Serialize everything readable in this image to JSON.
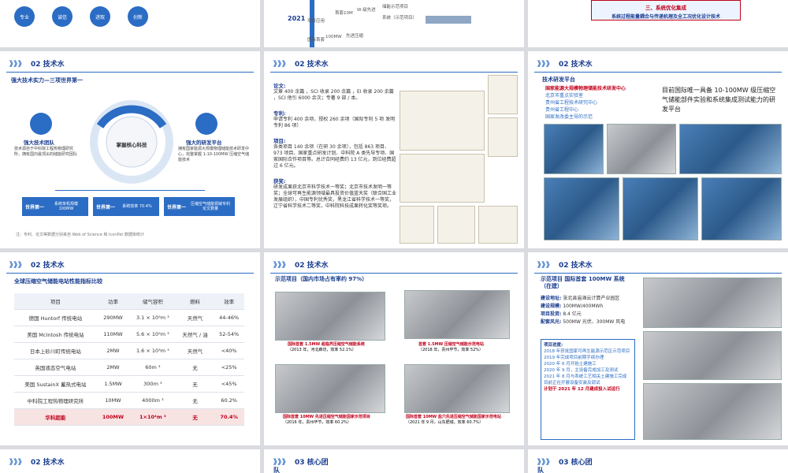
{
  "section_technical": "02  技术水",
  "section_core_team": "03  核心团",
  "section_core_team_tail": "队",
  "top_strip": {
    "tags": [
      "专业",
      "诚信",
      "进取",
      "创新"
    ],
    "timeline_year": "2021",
    "timeline_items": [
      "首套10M",
      "W 级先进",
      "储能示范项目",
      "系统（示范项目）",
      "国际首套",
      "100MW",
      "先进压缩"
    ],
    "timeline_labels": [
      "项目应用",
      "项目应用"
    ],
    "system_title": "三、系统优化集成",
    "system_desc": "系统过程能量耦合与传递机理及全工况优化设计技术"
  },
  "slide4": {
    "title": "强大技术实力—三项世界第一",
    "center": "掌握核心科技",
    "left_title": "强大技术团队",
    "left_desc": "技术源自于中科院工程热物理研究所，拥有国内最顶尖的储能研究团队",
    "right_title": "强大的研发平台",
    "right_desc": "拥有国家能源大规模物理储能技术研发中心，完整掌握 1-10-100MW 压缩空气储能技术",
    "boxes": [
      {
        "label": "世界第一",
        "text": "系统单机规模 100MW"
      },
      {
        "label": "世界第一",
        "text": "系统效率 70.4%"
      },
      {
        "label": "世界第一",
        "text": "压缩空气储能领域专利论文数量"
      }
    ],
    "note": "注：专利、论文等数据分别来自 Web of Science 和 IconPat 数据库统计"
  },
  "slide5": {
    "sections": [
      {
        "title": "论文:",
        "text": "文章 400 余篇 ，SCI 收录 200 余篇 ，EI 收录 200 余篇 ，SCI 他引 6000 余次；专著 9 部 / 本。"
      },
      {
        "title": "专利:",
        "text": "申请专利 400 余项，授权 260 余项（国际专利 5 项 发明专利 86 项）"
      },
      {
        "title": "项目:",
        "text": "各类项目 140 余项（在研 30 余项），包括 863 项目、973 项目、国家重点研发计划、中科院 A 类先导专项、国家国际合作项目等。总计合同经费约 13 亿元，到位经费超过 6 亿元。"
      },
      {
        "title": "获奖:",
        "text": "研发成果获北京市科学技术一等奖；北京市技术发明一等奖；全球可再生能源领域最具投资价值蓝天奖（联合国工业发展组织），中国专利优秀奖，黑龙江省科学技术一等奖，辽宁省科学技术二等奖，中科院科技成果转化奖等奖项。"
      }
    ]
  },
  "slide6": {
    "heading": "技术研发平台",
    "bullets": [
      "国家能源大规模物理储能技术研发中心",
      "北京市重点实验室",
      "贵州省工程技术研究中心",
      "贵州省工程中心",
      "国家发改委主导的示范"
    ],
    "callout": "目前国际唯一具备 10-100MW 级压缩空气储能部件实验和系统集成测试能力的研发平台"
  },
  "slide7": {
    "title": "全球压缩空气储能电站性能指标比较",
    "columns": [
      "项目",
      "功率",
      "储气容积",
      "燃料",
      "效率"
    ],
    "rows": [
      [
        "德国 Huntorf 传统电站",
        "290MW",
        "3.1 × 10⁵m ³",
        "天然气",
        "44-46%"
      ],
      [
        "美国 McIntosh 传统电站",
        "110MW",
        "5.6 × 10⁵m ³",
        "天然气 / 油",
        "52-54%"
      ],
      [
        "日本上砂川町传统电站",
        "2MW",
        "1.6 × 10³m ³",
        "天然气",
        "<40%"
      ],
      [
        "英国液态空气电站",
        "2MW",
        "60m ³",
        "无",
        "<25%"
      ],
      [
        "美国 SustainX 蓄热式电站",
        "1.5MW",
        "300m ³",
        "无",
        "<45%"
      ],
      [
        "中科院工程热物理研究所",
        "10MW",
        "4000m ³",
        "无",
        "60.2%"
      ],
      [
        "华科超能",
        "100MW",
        "1×10⁴m ³",
        "无",
        "70.4%"
      ]
    ]
  },
  "slide8": {
    "title": "示范项目（国内市场占有率约 97%）",
    "captions": [
      {
        "hl": "国际首套 1.5MW 超临界压缩空气储能系统",
        "sub": "（2013 年，河北廊坊，效率 52.1%）"
      },
      {
        "hl": "首套 1.5MW 压缩空气储能示范电站",
        "sub": "（2018 年，贵州毕节，效率 52%）"
      },
      {
        "hl": "国际首套 10MW 先进压缩空气储能国家示范项目",
        "sub": "（2016 年，贵州毕节，效率 60.2%）"
      },
      {
        "hl": "国际首套 10MW 盐穴先进压缩空气储能国家示范电站",
        "sub": "（2021 年 9 月，山东肥城，效率 60.7%）"
      }
    ]
  },
  "slide9": {
    "title": "示范项目  国际首套 100MW 系统（在建）",
    "fields": [
      {
        "k": "建设地址:",
        "v": "张北县庙滩云计算产业园区"
      },
      {
        "k": "建设规模:",
        "v": "100MW/400MWh"
      },
      {
        "k": "项目投资:",
        "v": "8.4 亿元"
      },
      {
        "k": "配套风光:",
        "v": "500MW 光伏、300MW 风电"
      }
    ],
    "progress_title": "项目进度:",
    "progress": [
      "2018 年获批国家可再生能源示范区示范项目",
      "2019 年完成项目前期手续办理",
      "2020 年 6 月开始土建施工",
      "2020 年 9 月，主设备完成加工及测试",
      "2021 年 8 月与系统工艺相关土建施工完成",
      "目前正在开展设备安装及调试",
      "计划于 2021 年 12 月建成投入试运行"
    ]
  }
}
